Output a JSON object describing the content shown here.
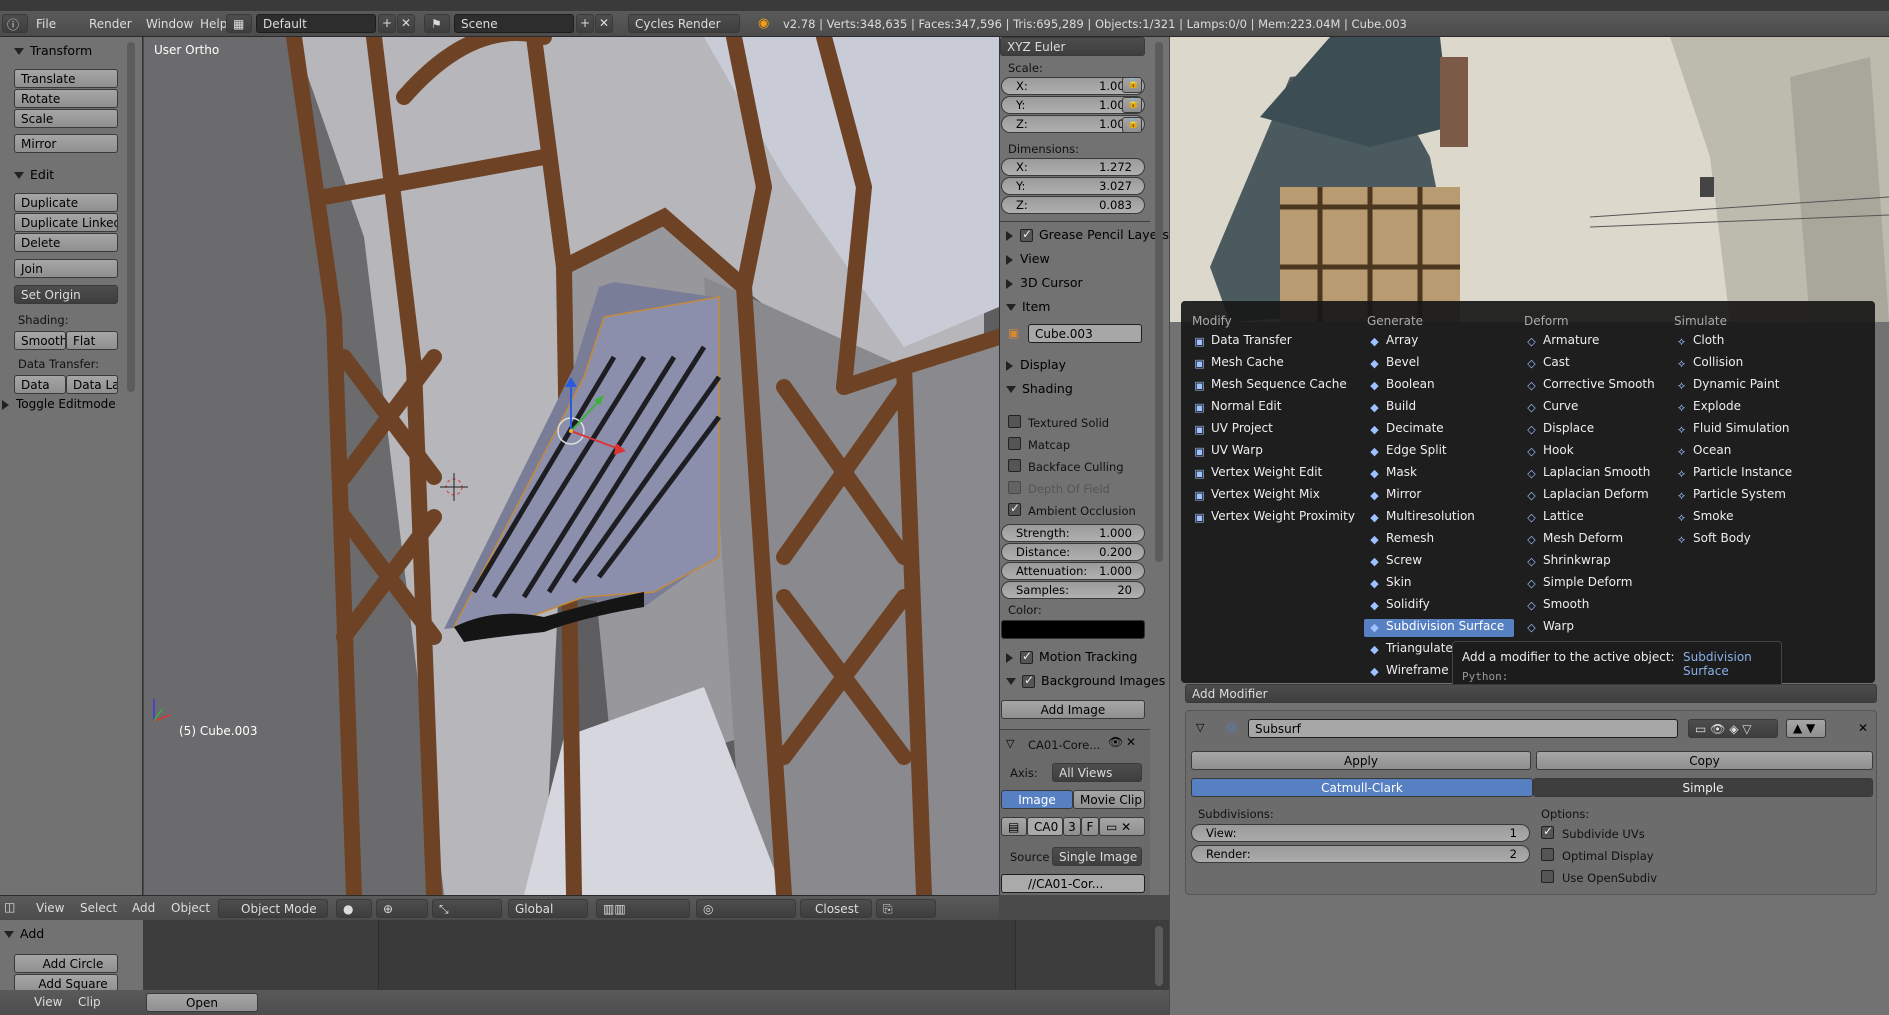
{
  "window_title_strip": "",
  "topbar": {
    "menus": [
      "File",
      "Render",
      "Window",
      "Help"
    ],
    "layout": "Default",
    "scene": "Scene",
    "engine": "Cycles Render",
    "stats": "v2.78 | Verts:348,635 | Faces:347,596 | Tris:695,289 | Objects:1/321 | Lamps:0/0 | Mem:223.04M | Cube.003"
  },
  "toolshelf": {
    "transform_title": "Transform",
    "translate": "Translate",
    "rotate": "Rotate",
    "scale": "Scale",
    "mirror": "Mirror",
    "edit_title": "Edit",
    "duplicate": "Duplicate",
    "duplicate_linked": "Duplicate Linked",
    "delete": "Delete",
    "join": "Join",
    "set_origin": "Set Origin",
    "shading_label": "Shading:",
    "smooth": "Smooth",
    "flat": "Flat",
    "data_transfer_label": "Data Transfer:",
    "data": "Data",
    "data_la": "Data La",
    "toggle_editmode": "Toggle Editmode"
  },
  "viewport": {
    "view_name": "User Ortho",
    "object_label": "(5) Cube.003",
    "header": {
      "view": "View",
      "select": "Select",
      "add": "Add",
      "object": "Object",
      "mode": "Object Mode",
      "orientation": "Global",
      "snap": "Closest"
    }
  },
  "properties": {
    "rotation_mode": "XYZ Euler",
    "scale_label": "Scale:",
    "scale": {
      "x": "1.000",
      "y": "1.000",
      "z": "1.000"
    },
    "dimensions_label": "Dimensions:",
    "dimensions": {
      "x": "1.272",
      "y": "3.027",
      "z": "0.083"
    },
    "panels": {
      "grease": "Grease Pencil Layers",
      "view": "View",
      "cursor": "3D Cursor",
      "item": "Item",
      "display": "Display",
      "shading": "Shading"
    },
    "item_name": "Cube.003",
    "shading_opts": [
      "Textured Solid",
      "Matcap",
      "Backface Culling",
      "Depth Of Field",
      "Ambient Occlusion"
    ],
    "ao": {
      "strength_l": "Strength:",
      "strength": "1.000",
      "distance_l": "Distance:",
      "distance": "0.200",
      "atten_l": "Attenuation:",
      "atten": "1.000",
      "samples_l": "Samples:",
      "samples": "20"
    },
    "color_label": "Color:",
    "motion_tracking": "Motion Tracking",
    "background_images": "Background Images",
    "add_image": "Add Image",
    "bg_name": "CA01-Core...",
    "axis_label": "Axis:",
    "axis": "All Views",
    "image_tab": "Image",
    "movie_tab": "Movie Clip",
    "img_short": "CA0",
    "img_users": "3",
    "img_f": "F",
    "source_label": "Source",
    "source": "Single Image",
    "path": "//CA01-Cor..."
  },
  "bottom": {
    "add_title": "Add",
    "add_circle": "Add Circle",
    "add_square": "Add Square",
    "view": "View",
    "clip": "Clip",
    "open": "Open"
  },
  "modifier_menu": {
    "columns": [
      {
        "title": "Modify",
        "items": [
          "Data Transfer",
          "Mesh Cache",
          "Mesh Sequence Cache",
          "Normal Edit",
          "UV Project",
          "UV Warp",
          "Vertex Weight Edit",
          "Vertex Weight Mix",
          "Vertex Weight Proximity"
        ]
      },
      {
        "title": "Generate",
        "items": [
          "Array",
          "Bevel",
          "Boolean",
          "Build",
          "Decimate",
          "Edge Split",
          "Mask",
          "Mirror",
          "Multiresolution",
          "Remesh",
          "Screw",
          "Skin",
          "Solidify",
          "Subdivision Surface",
          "Triangulate",
          "Wireframe"
        ]
      },
      {
        "title": "Deform",
        "items": [
          "Armature",
          "Cast",
          "Corrective Smooth",
          "Curve",
          "Displace",
          "Hook",
          "Laplacian Smooth",
          "Laplacian Deform",
          "Lattice",
          "Mesh Deform",
          "Shrinkwrap",
          "Simple Deform",
          "Smooth",
          "Warp"
        ]
      },
      {
        "title": "Simulate",
        "items": [
          "Cloth",
          "Collision",
          "Dynamic Paint",
          "Explode",
          "Fluid Simulation",
          "Ocean",
          "Particle Instance",
          "Particle System",
          "Smoke",
          "Soft Body"
        ]
      }
    ],
    "tooltip": {
      "text": "Add a modifier to the active object:",
      "name": "Subdivision Surface",
      "python": "Python: bpy.ops.object.modifier_add(type='SUBSURF')"
    }
  },
  "modifier_panel": {
    "add_modifier": "Add Modifier",
    "name": "Subsurf",
    "apply": "Apply",
    "copy": "Copy",
    "catmull": "Catmull-Clark",
    "simple": "Simple",
    "subdivisions": "Subdivisions:",
    "view_l": "View:",
    "view": "1",
    "render_l": "Render:",
    "render": "2",
    "options": "Options:",
    "subdivide_uvs": "Subdivide UVs",
    "optimal_display": "Optimal Display",
    "use_opensubdiv": "Use OpenSubdiv"
  },
  "colors": {
    "accent": "#5680c2",
    "panel": "#727272",
    "menu": "#1e1e1e"
  }
}
